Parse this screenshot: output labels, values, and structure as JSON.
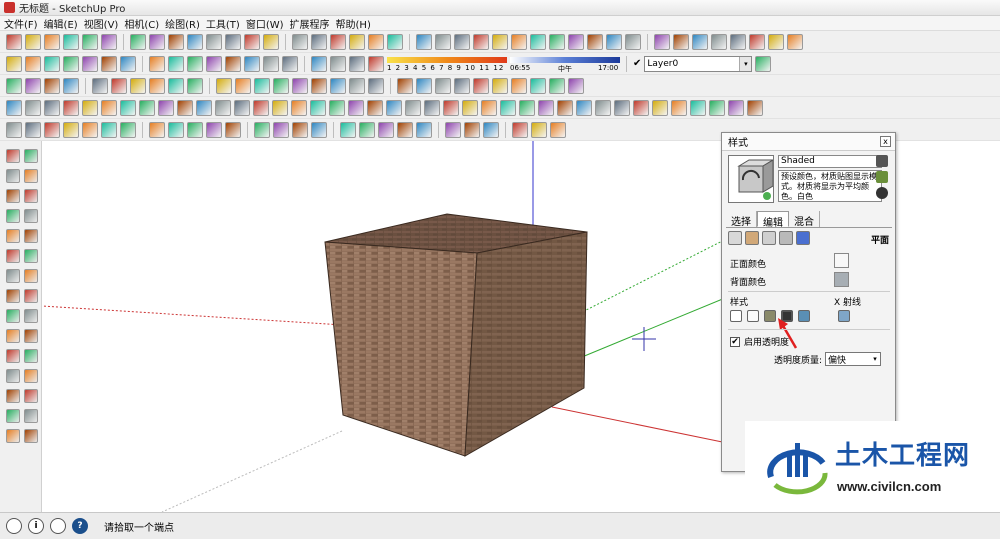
{
  "window": {
    "title": "无标题 - SketchUp Pro"
  },
  "menu": [
    "文件(F)",
    "编辑(E)",
    "视图(V)",
    "相机(C)",
    "绘图(R)",
    "工具(T)",
    "窗口(W)",
    "扩展程序",
    "帮助(H)"
  ],
  "toolbar": {
    "shadow_months": "1 2 3 4 5 6 7 8 9 10 11 12",
    "time_start": "06:55",
    "time_mid": "中午",
    "time_end": "17:00",
    "layer_check": "✔",
    "layer_value": "Layer0",
    "dropdown_glyph": "▾"
  },
  "styles_panel": {
    "title": "样式",
    "close": "x",
    "style_name": "Shaded",
    "style_description": "预设颜色，材质贴图显示模式。材质将显示为平均颜色。白色",
    "tabs": [
      "选择",
      "编辑",
      "混合"
    ],
    "active_tab": 1,
    "face_label": "平面",
    "front_color_label": "正面颜色",
    "back_color_label": "背面颜色",
    "front_color": "#f8f8f8",
    "back_color": "#a7aeb4",
    "style_label": "样式",
    "xray_label": "X 射线",
    "transparency_label": "启用透明度",
    "transparency_checked": "✔",
    "quality_label": "透明度质量:",
    "quality_value": "偏快"
  },
  "status_bar": {
    "text": "请拾取一个端点",
    "help_glyph": "?",
    "info_glyph": "i"
  },
  "watermark": {
    "title": "土木工程网",
    "url": "www.civilcn.com"
  },
  "colors": {
    "axis_blue": "#3333cc",
    "axis_green": "#33aa33",
    "axis_red": "#cc3333",
    "brick_front": "#8b6a55",
    "brick_side": "#735844",
    "brick_top": "#6b5040",
    "highlight_arrow": "#e02020",
    "watermark_blue": "#1a55a8"
  }
}
